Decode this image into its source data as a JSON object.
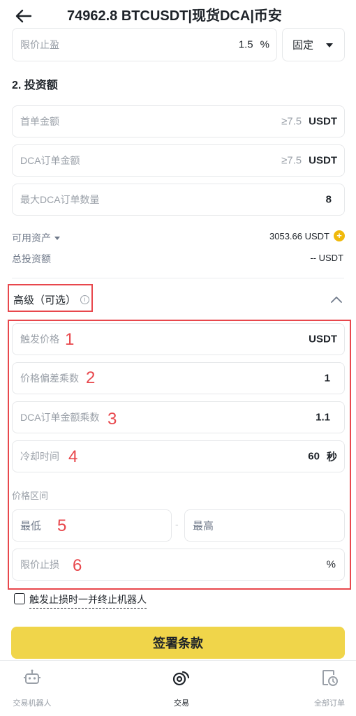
{
  "header": {
    "title": "74962.8 BTCUSDT|现货DCA|币安"
  },
  "take_profit": {
    "label": "限价止盈",
    "value": "1.5",
    "unit": "%",
    "mode": "固定"
  },
  "investment": {
    "section_title": "2. 投资额",
    "first_order": {
      "label": "首单金额",
      "hint": "≥7.5",
      "unit": "USDT"
    },
    "dca_order": {
      "label": "DCA订单金额",
      "hint": "≥7.5",
      "unit": "USDT"
    },
    "max_dca": {
      "label": "最大DCA订单数量",
      "value": "8"
    },
    "available": {
      "label": "可用资产",
      "value": "3053.66 USDT"
    },
    "total": {
      "label": "总投资额",
      "value": "-- USDT"
    }
  },
  "advanced": {
    "title": "高级（可选）",
    "trigger_price": {
      "label": "触发价格",
      "unit": "USDT"
    },
    "price_deviation": {
      "label": "价格偏差乘数",
      "value": "1"
    },
    "dca_multiplier": {
      "label": "DCA订单金额乘数",
      "value": "1.1"
    },
    "cooldown": {
      "label": "冷却时间",
      "value": "60",
      "unit": "秒"
    },
    "price_range": {
      "label": "价格区间",
      "min_placeholder": "最低",
      "separator": "-",
      "max_placeholder": "最高"
    },
    "stop_loss": {
      "label": "限价止损",
      "unit": "%"
    }
  },
  "annotations": [
    "1",
    "2",
    "3",
    "4",
    "5",
    "6"
  ],
  "terminate_checkbox": {
    "label": "触发止损时一并终止机器人",
    "checked": false
  },
  "sign_button": {
    "label": "签署条款"
  },
  "tabbar": {
    "items": [
      {
        "label": "交易机器人"
      },
      {
        "label": "交易"
      },
      {
        "label": "全部订单"
      }
    ],
    "active": "交易"
  },
  "colors": {
    "accent": "#F0D54A",
    "annotation": "#E8474C",
    "coin": "#F0B90B"
  }
}
